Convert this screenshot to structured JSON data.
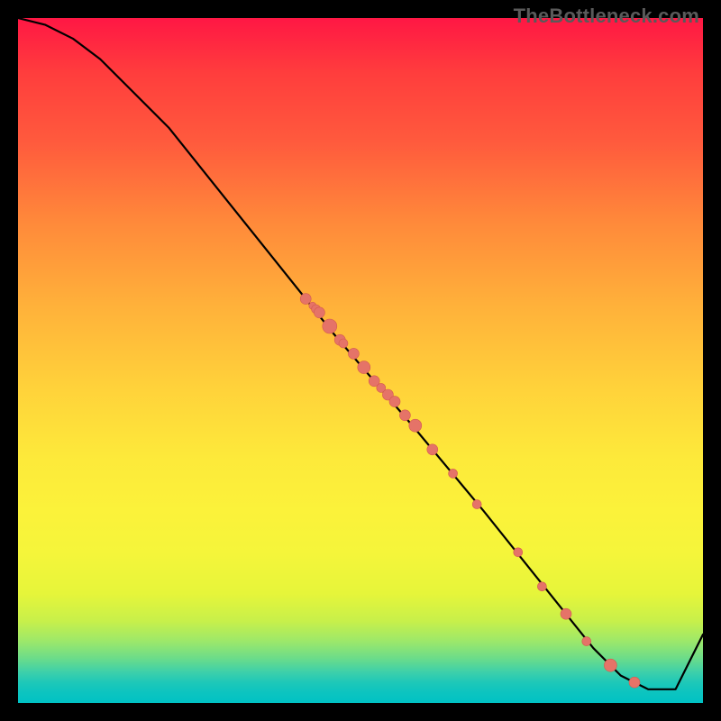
{
  "watermark": "TheBottleneck.com",
  "colors": {
    "dot_fill": "#e57368",
    "dot_stroke": "#d45a4e",
    "curve": "#000000",
    "frame": "#000000"
  },
  "chart_data": {
    "type": "line",
    "title": "",
    "xlabel": "",
    "ylabel": "",
    "xlim": [
      0,
      100
    ],
    "ylim": [
      0,
      100
    ],
    "curve": {
      "x": [
        0,
        4,
        8,
        12,
        16,
        22,
        34,
        46,
        58,
        68,
        76,
        80,
        84,
        88,
        92,
        96,
        100
      ],
      "y": [
        100,
        99,
        97,
        94,
        90,
        84,
        69,
        54,
        40,
        28,
        18,
        13,
        8,
        4,
        2,
        2,
        10
      ]
    },
    "series": [
      {
        "name": "points",
        "x": [
          42,
          43,
          43.5,
          44,
          45.5,
          47,
          47.5,
          49,
          50.5,
          52,
          53,
          54,
          55,
          56.5,
          58,
          60.5,
          63.5,
          67,
          73,
          76.5,
          80,
          83,
          86.5,
          90
        ],
        "y": [
          59,
          58,
          57.5,
          57,
          55,
          53,
          52.5,
          51,
          49,
          47,
          46,
          45,
          44,
          42,
          40.5,
          37,
          33.5,
          29,
          22,
          17,
          13,
          9,
          5.5,
          3
        ],
        "r": [
          6,
          4,
          5,
          6,
          8,
          6,
          5,
          6,
          7,
          6,
          5,
          6,
          6,
          6,
          7,
          6,
          5,
          5,
          5,
          5,
          6,
          5,
          7,
          6
        ]
      }
    ]
  }
}
